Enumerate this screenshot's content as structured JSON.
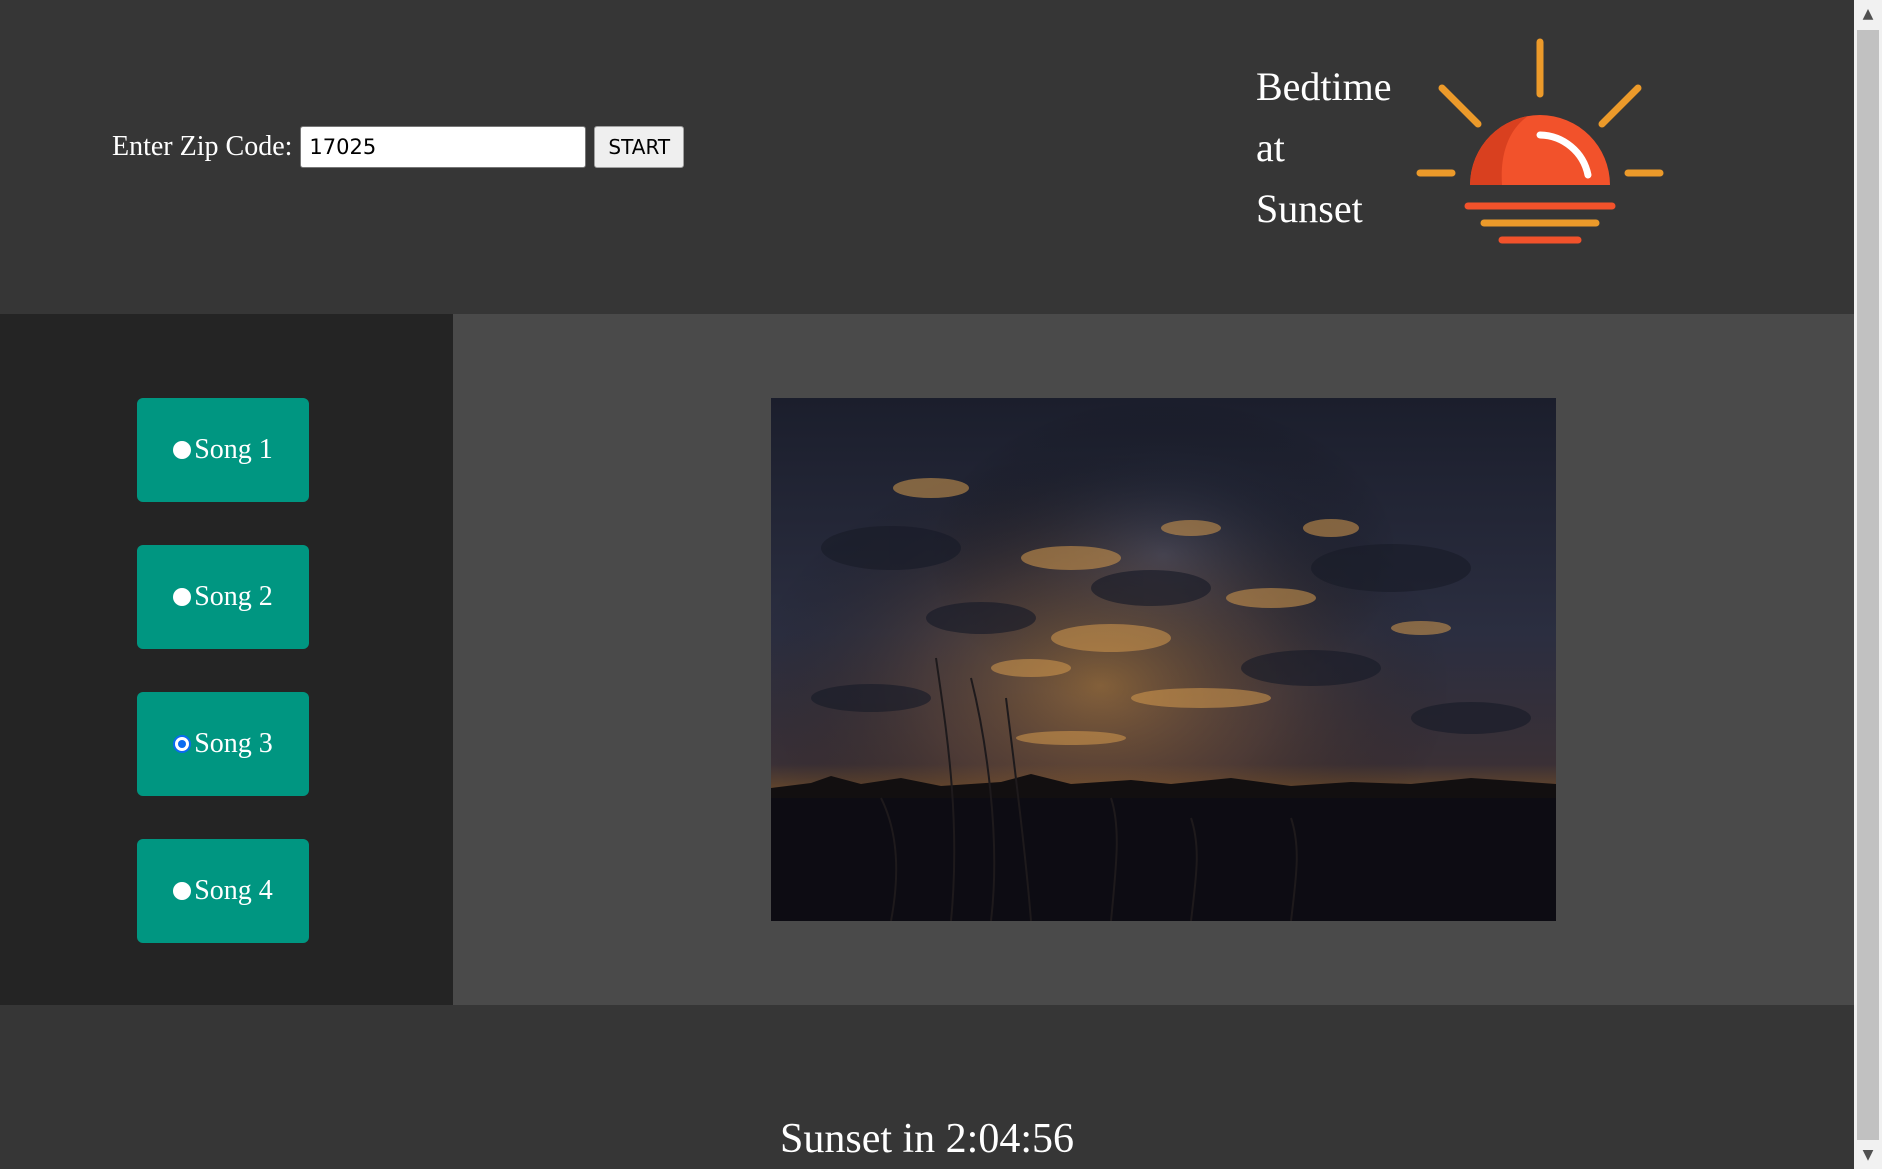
{
  "header": {
    "zip_label": "Enter Zip Code:",
    "zip_value": "17025",
    "start_label": "START",
    "brand_lines": [
      "Bedtime",
      "at",
      "Sunset"
    ]
  },
  "sidebar": {
    "songs": [
      {
        "label": "Song 1",
        "checked": false
      },
      {
        "label": "Song 2",
        "checked": false
      },
      {
        "label": "Song 3",
        "checked": true
      },
      {
        "label": "Song 4",
        "checked": false
      }
    ]
  },
  "footer": {
    "countdown": "Sunset in 2:04:56"
  },
  "colors": {
    "header_bg": "#363636",
    "sidebar_bg": "#242424",
    "panel_bg": "#4a4a4a",
    "song_button": "#009681",
    "sun_red": "#f2522b",
    "sun_orange": "#ec9a2a"
  },
  "icons": {
    "logo": "sunset-icon",
    "scroll_up": "chevron-up-icon",
    "scroll_down": "chevron-down-icon"
  }
}
